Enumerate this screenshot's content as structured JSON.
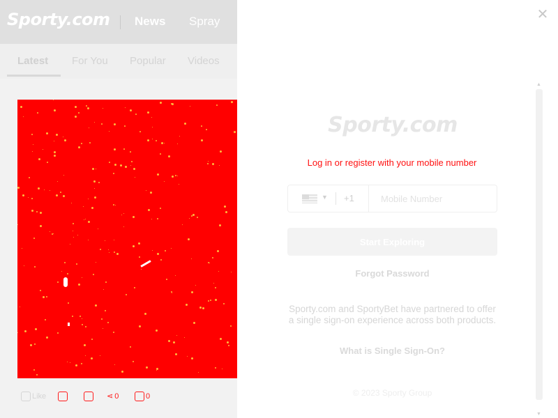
{
  "header": {
    "logo": "Sporty.com",
    "nav": [
      "News",
      "Spray"
    ]
  },
  "tabs": [
    "Latest",
    "For You",
    "Popular",
    "Videos"
  ],
  "article": {
    "likes": "Like",
    "shares": "0",
    "comments": "0"
  },
  "modal": {
    "logo": "Sporty.com",
    "prompt": "Log in or register with your mobile number",
    "country": {
      "flag": "us-flag-icon",
      "dial_code": "+1"
    },
    "phone_placeholder": "Mobile Number",
    "start_button": "Start Exploring",
    "forgot_password": "Forgot Password",
    "info_text": "Sporty.com and SportyBet have partnered to offer a single sign-on experience across both products.",
    "sso_link": "What is Single Sign-On?",
    "copyright": "© 2023 Sporty Group",
    "close_icon": "close-icon"
  },
  "colors": {
    "hero_fill": "#ff0000",
    "prompt_text": "#ff1111"
  }
}
